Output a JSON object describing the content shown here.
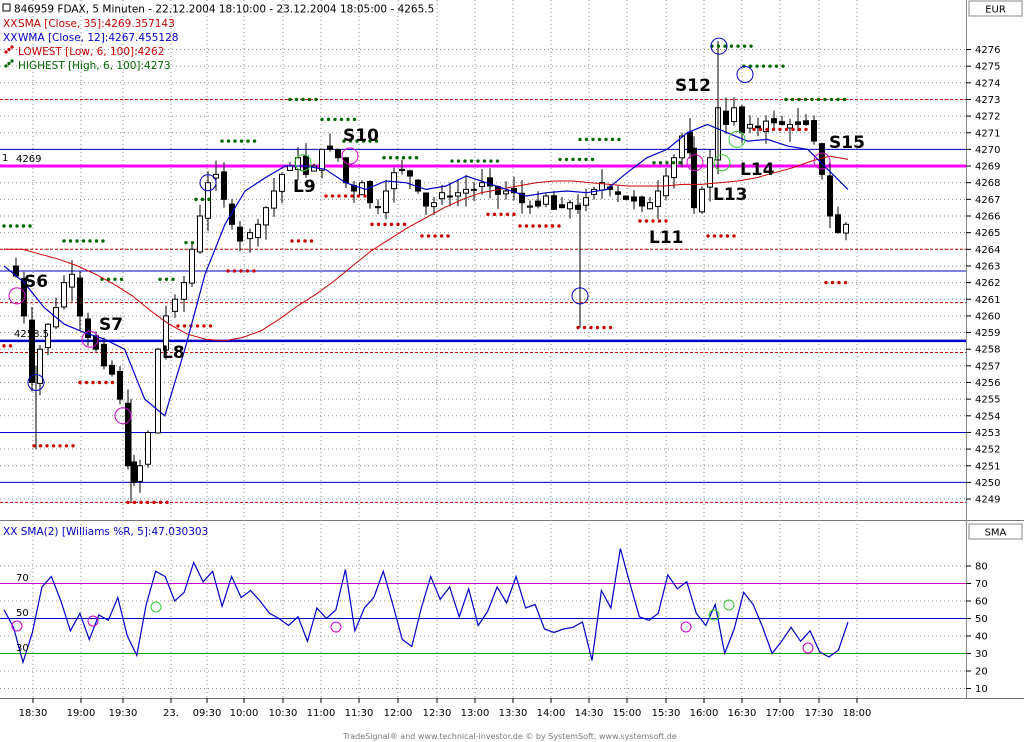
{
  "header": {
    "title": "846959  FDAX, 5 Minuten - 22.12.2004 18:10:00 - 23.12.2004 18:05:00 - 4265.5"
  },
  "legend": [
    {
      "text": "SMA [Close, 35]:4269.357143",
      "color": "#cc0000",
      "marker": "XX"
    },
    {
      "text": "WMA [Close, 12]:4267.455128",
      "color": "#0000cc",
      "marker": "XX"
    },
    {
      "text": "LOWEST [Low, 6, 100]:4262",
      "color": "#cc0000",
      "marker": "dots"
    },
    {
      "text": "HIGHEST [High, 6, 100]:4273",
      "color": "#006600",
      "marker": "dots"
    }
  ],
  "price_panel": {
    "currency_tab": "EUR",
    "y_ticks": [
      "4276",
      "4275",
      "4274",
      "4273",
      "4272",
      "4271",
      "4270",
      "4269",
      "4268",
      "4267",
      "4266",
      "4265",
      "4264",
      "4263",
      "4262",
      "4261",
      "4260",
      "4259",
      "4258",
      "4257",
      "4256",
      "4255",
      "4254",
      "4253",
      "4252",
      "4251",
      "4250",
      "4249"
    ],
    "level_labels": {
      "magenta_index": "1",
      "magenta_value": "4269",
      "blue_value": "4258.5"
    },
    "signal_labels": [
      {
        "text": "S6",
        "x": "18:30",
        "y": 4262.6
      },
      {
        "text": "S7",
        "x": "19:15",
        "y": 4259.7
      },
      {
        "text": "L8",
        "x": "19:45",
        "y": 4258.2
      },
      {
        "text": "L9",
        "x": "10:30",
        "y": 4267.8
      },
      {
        "text": "S10",
        "x": "11:15",
        "y": 4271.2
      },
      {
        "text": "L11",
        "x": "15:15",
        "y": 4265.1
      },
      {
        "text": "S12",
        "x": "15:45",
        "y": 4273.6
      },
      {
        "text": "L13",
        "x": "16:30",
        "y": 4267.4
      },
      {
        "text": "L14",
        "x": "17:00",
        "y": 4268.8
      },
      {
        "text": "S15",
        "x": "17:45",
        "y": 4270.5
      }
    ]
  },
  "indicator_panel": {
    "title": "XX SMA(2) [Williams %R, 5]:47.030303",
    "tab": "SMA",
    "y_ticks": [
      "80",
      "70",
      "60",
      "50",
      "40",
      "30",
      "20",
      "10"
    ],
    "level_labels": [
      "70",
      "50",
      "30"
    ]
  },
  "x_axis": {
    "ticks": [
      "18:30",
      "19:00",
      "19:30",
      "23.",
      "09:30",
      "10:00",
      "10:30",
      "11:00",
      "11:30",
      "12:00",
      "12:30",
      "13:00",
      "13:30",
      "14:00",
      "14:30",
      "15:00",
      "15:30",
      "16:00",
      "16:30",
      "17:00",
      "17:30",
      "18:00"
    ]
  },
  "footer": {
    "text": "TradeSignal® and www.technical-investor.de © by  SystemSoft, www.systemsoft.de"
  },
  "colors": {
    "sma": "#cc0000",
    "wma": "#0000cc",
    "lowest": "#cc0000",
    "highest": "#006600",
    "level_magenta": "#ff00ff",
    "level_blue": "#0000cc",
    "grid": "#888888",
    "green_circle": "#33cc33"
  },
  "chart_data": [
    {
      "type": "candlestick",
      "title": "FDAX, 5 Minuten",
      "xlabel": "",
      "ylabel": "",
      "ylim": [
        4248.5,
        4277
      ],
      "horizontal_levels": [
        4269,
        4258.5,
        4273,
        4264,
        4262.7,
        4260.8,
        4257.8,
        4253,
        4250,
        4248.8
      ],
      "series": [
        {
          "name": "SMA [Close, 35]",
          "values": [
            4264,
            4264,
            4263.7,
            4263.4,
            4263,
            4262.5,
            4261.9,
            4261.2,
            4260.3,
            4259.5,
            4258.9,
            4258.6,
            4258.5,
            4258.7,
            4259.1,
            4259.8,
            4260.6,
            4261.3,
            4262.1,
            4263,
            4263.9,
            4264.6,
            4265.3,
            4265.9,
            4266.5,
            4267,
            4267.4,
            4267.6,
            4267.8,
            4268,
            4268.1,
            4268.1,
            4268,
            4267.9,
            4267.8,
            4267.8,
            4267.8,
            4267.9,
            4267.9,
            4268,
            4268.1,
            4268.3,
            4268.6,
            4268.9,
            4269.3,
            4269.6,
            4269.4
          ]
        },
        {
          "name": "WMA [Close, 12]",
          "values": [
            4263,
            4262,
            4260.5,
            4259.5,
            4259,
            4258.6,
            4258,
            4255,
            4254,
            4258,
            4262.5,
            4265.5,
            4267.5,
            4268.3,
            4269,
            4269,
            4268.8,
            4268,
            4267.6,
            4268.1,
            4268,
            4267.6,
            4267.8,
            4268.4,
            4268,
            4267.6,
            4267.2,
            4267.4,
            4267.5,
            4267.4,
            4267.6,
            4268.6,
            4269.5,
            4270,
            4271,
            4271.5,
            4271,
            4270.5,
            4270.6,
            4270.2,
            4270,
            4268.8,
            4267.6
          ]
        }
      ],
      "ohlc_sample": [
        {
          "time": "18:10",
          "open": 4263,
          "high": 4264,
          "low": 4261.8,
          "close": 4262.5
        },
        {
          "time": "18:25",
          "open": 4259.5,
          "high": 4260,
          "low": 4255.5,
          "close": 4256
        },
        {
          "time": "19:30",
          "open": 4254.5,
          "high": 4255,
          "low": 4249,
          "close": 4250
        },
        {
          "time": "14:25",
          "open": 4266.2,
          "high": 4266.8,
          "low": 4259.3,
          "close": 4266.4
        },
        {
          "time": "16:05",
          "open": 4270.4,
          "high": 4276.5,
          "low": 4268.5,
          "close": 4271.8
        },
        {
          "time": "18:05",
          "open": 4265,
          "high": 4265.8,
          "low": 4264,
          "close": 4265.5
        }
      ]
    },
    {
      "type": "line",
      "title": "SMA(2) [Williams %R, 5]",
      "xlabel": "",
      "ylabel": "",
      "ylim": [
        6,
        94
      ],
      "horizontal_levels": [
        70,
        50,
        30
      ],
      "series": [
        {
          "name": "SMA(2) [Williams %R, 5]",
          "values": [
            55,
            45,
            25,
            42,
            68,
            74,
            60,
            43,
            53,
            38,
            52,
            49,
            62,
            40,
            29,
            58,
            77,
            74,
            60,
            65,
            82,
            71,
            77,
            57,
            74,
            62,
            66,
            60,
            53,
            50,
            46,
            51,
            37,
            56,
            50,
            55,
            78,
            43,
            56,
            62,
            77,
            58,
            38,
            34,
            56,
            74,
            61,
            68,
            51,
            67,
            46,
            54,
            68,
            59,
            74,
            56,
            58,
            44,
            42,
            44,
            45,
            48,
            26,
            66,
            56,
            90,
            70,
            51,
            49,
            53,
            75,
            67,
            71,
            53,
            46,
            58,
            30,
            44,
            65,
            58,
            45,
            30,
            37,
            45,
            37,
            43,
            31,
            28,
            32,
            48
          ]
        }
      ]
    }
  ]
}
